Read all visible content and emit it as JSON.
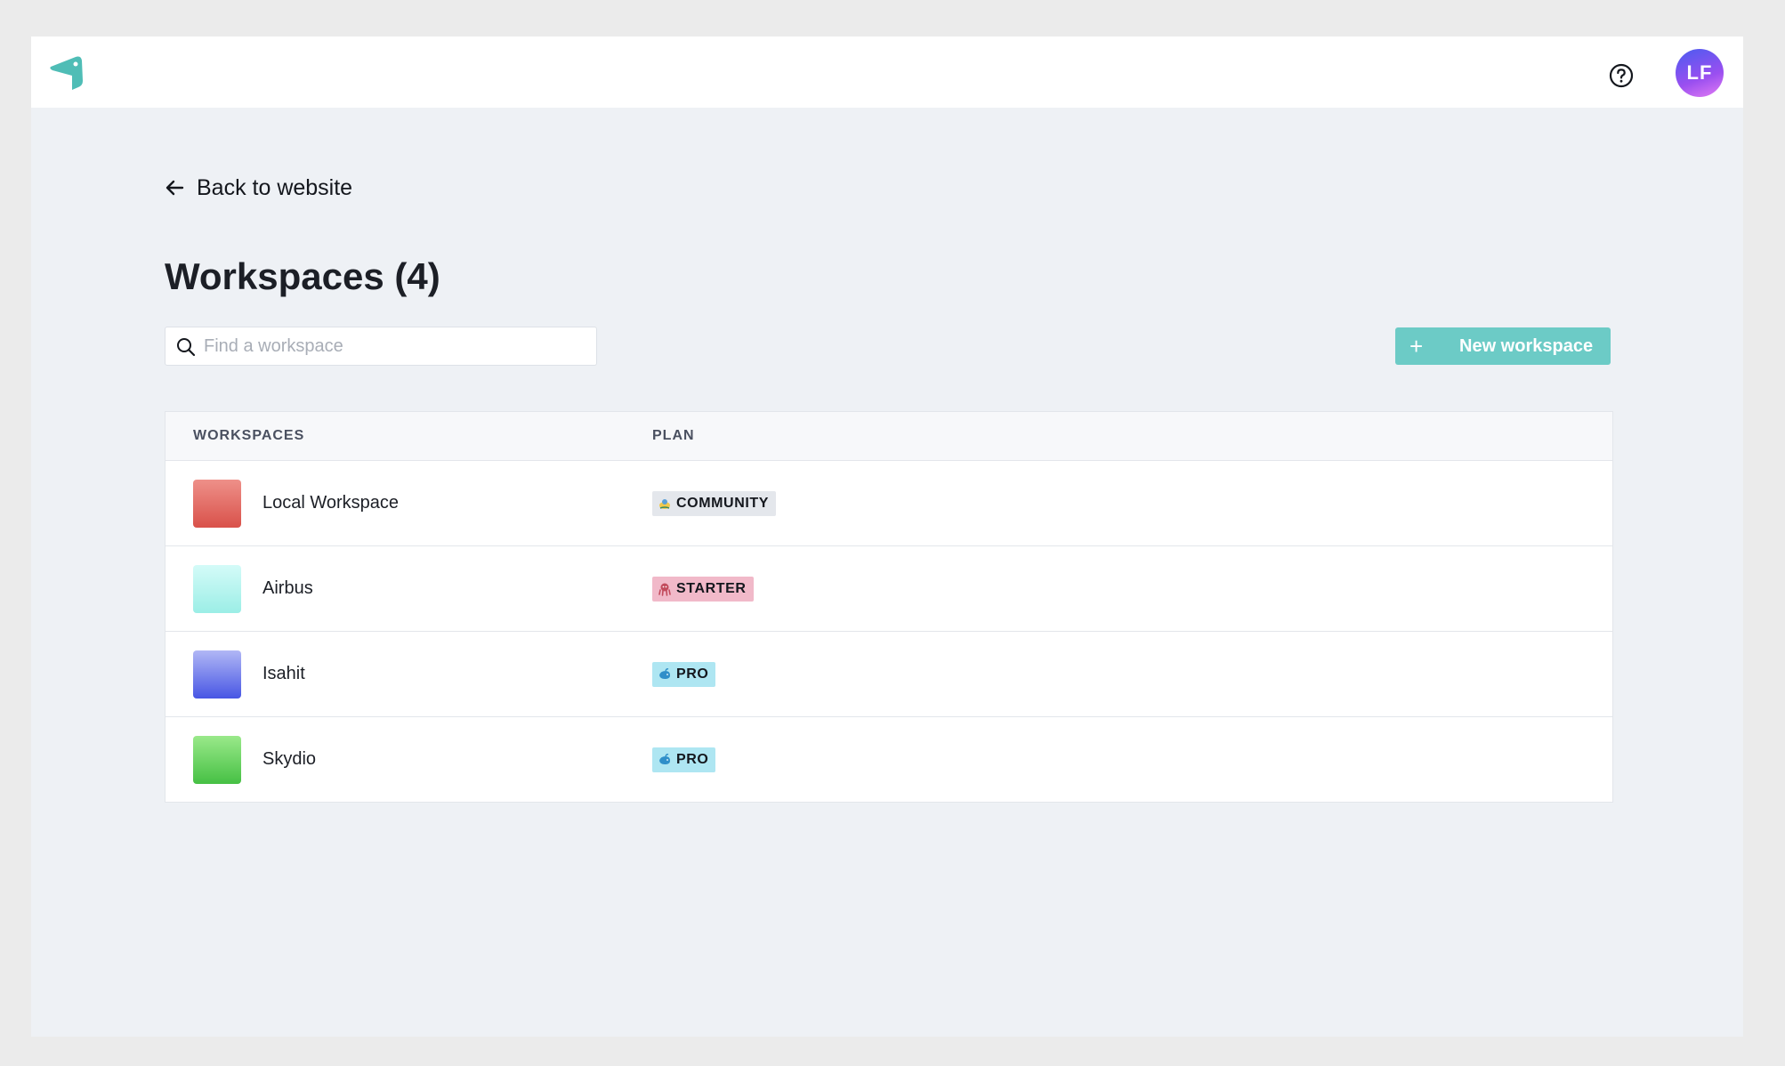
{
  "header": {
    "logo_icon": "brand-logo-icon",
    "help_icon": "help-circle-icon",
    "avatar_initials": "LF"
  },
  "nav": {
    "back_label": "Back to website",
    "back_icon": "arrow-left-icon"
  },
  "page": {
    "title": "Workspaces (4)"
  },
  "search": {
    "placeholder": "Find a workspace",
    "value": "",
    "icon": "search-icon"
  },
  "actions": {
    "new_workspace_label": "New workspace",
    "new_workspace_icon": "plus-icon"
  },
  "table": {
    "headers": [
      "WORKSPACES",
      "PLAN"
    ],
    "rows": [
      {
        "name": "Local Workspace",
        "plan": "COMMUNITY",
        "plan_icon": "community-icon"
      },
      {
        "name": "Airbus",
        "plan": "STARTER",
        "plan_icon": "starter-icon"
      },
      {
        "name": "Isahit",
        "plan": "PRO",
        "plan_icon": "pro-icon"
      },
      {
        "name": "Skydio",
        "plan": "PRO",
        "plan_icon": "pro-icon"
      }
    ]
  },
  "colors": {
    "accent": "#6ccbc6",
    "badge_community": "#e4e7ec",
    "badge_starter": "#f1b9c9",
    "badge_pro": "#aee6f2"
  }
}
